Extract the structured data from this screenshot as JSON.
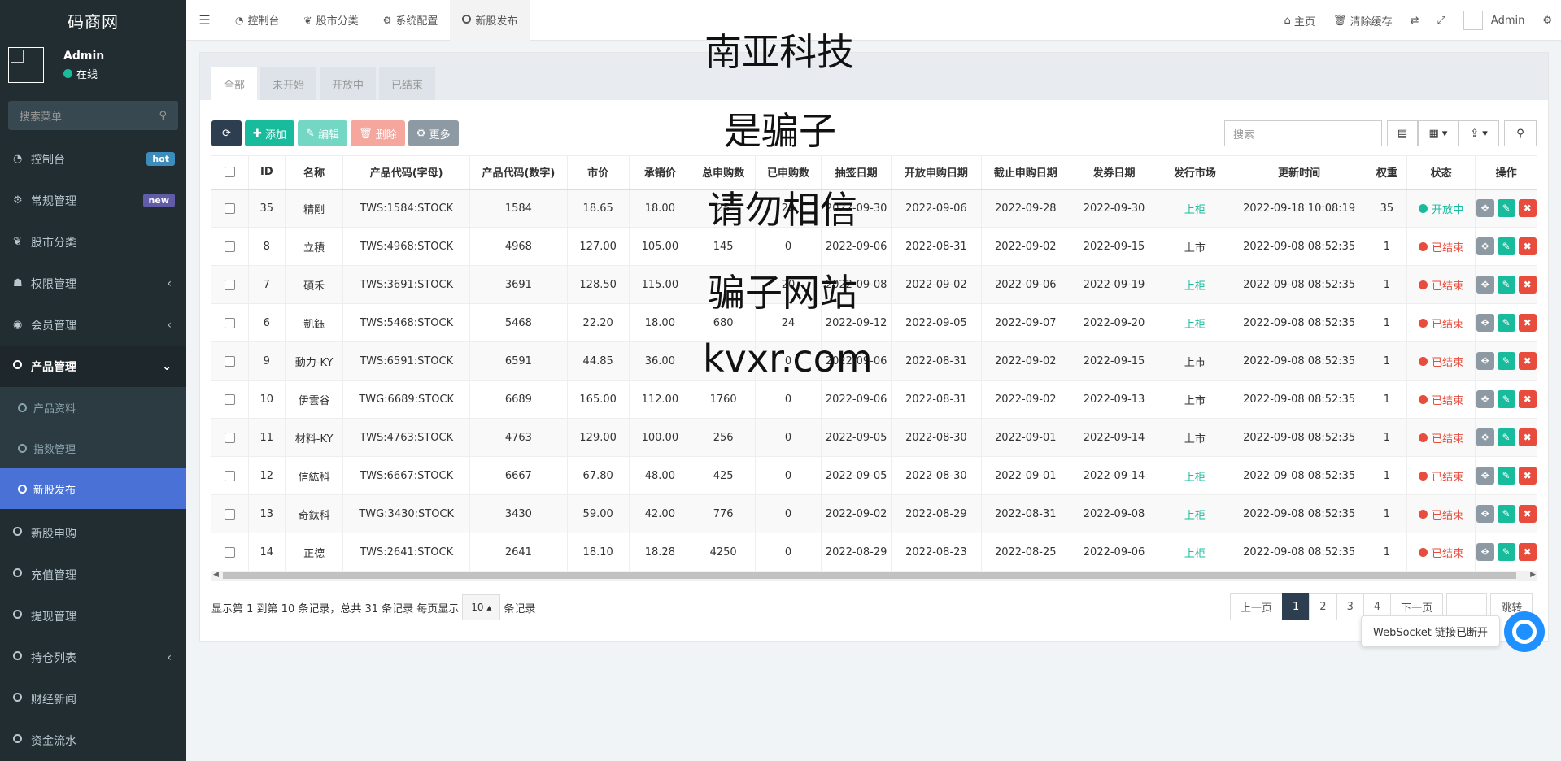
{
  "sidebar": {
    "logo": "码商网",
    "user": {
      "name": "Admin",
      "status": "在线"
    },
    "search_placeholder": "搜索菜单",
    "items": [
      {
        "label": "控制台",
        "icon": "dashboard-icon",
        "badge": "hot"
      },
      {
        "label": "常规管理",
        "icon": "cogs-icon",
        "badge": "new"
      },
      {
        "label": "股市分类",
        "icon": "leaf-icon"
      },
      {
        "label": "权限管理",
        "icon": "users-icon",
        "arrow": "‹"
      },
      {
        "label": "会员管理",
        "icon": "user-circle-icon",
        "arrow": "‹"
      },
      {
        "label": "产品管理",
        "icon": "circle-icon",
        "arrow": "⌄"
      }
    ],
    "sub_items": [
      "产品资料",
      "指数管理",
      "新股发布"
    ],
    "items_after": [
      {
        "label": "新股申购"
      },
      {
        "label": "充值管理"
      },
      {
        "label": "提现管理"
      },
      {
        "label": "持仓列表",
        "arrow": "‹"
      },
      {
        "label": "财经新闻"
      },
      {
        "label": "资金流水"
      }
    ]
  },
  "topbar": {
    "tabs": [
      "控制台",
      "股市分类",
      "系统配置",
      "新股发布"
    ],
    "right": {
      "home": "主页",
      "clear_cache": "清除缓存",
      "admin": "Admin"
    }
  },
  "panel": {
    "tabs": [
      "全部",
      "未开始",
      "开放中",
      "已结束"
    ],
    "toolbar": {
      "add": "添加",
      "edit": "编辑",
      "delete": "删除",
      "more": "更多"
    },
    "search_placeholder": "搜索"
  },
  "table": {
    "columns": [
      "ID",
      "名称",
      "产品代码(字母)",
      "产品代码(数字)",
      "市价",
      "承销价",
      "总申购数",
      "已申购数",
      "抽签日期",
      "开放申购日期",
      "截止申购日期",
      "发券日期",
      "发行市场",
      "更新时间",
      "权重",
      "状态",
      "操作"
    ],
    "rows": [
      [
        "35",
        "精剛",
        "TWS:1584:STOCK",
        "1584",
        "18.65",
        "18.00",
        "25",
        "20",
        "2022-09-30",
        "2022-09-06",
        "2022-09-28",
        "2022-09-30",
        "上柜",
        "2022-09-18 10:08:19",
        "35",
        "开放中"
      ],
      [
        "8",
        "立積",
        "TWS:4968:STOCK",
        "4968",
        "127.00",
        "105.00",
        "145",
        "0",
        "2022-09-06",
        "2022-08-31",
        "2022-09-02",
        "2022-09-15",
        "上市",
        "2022-09-08 08:52:35",
        "1",
        "已结束"
      ],
      [
        "7",
        "碩禾",
        "TWS:3691:STOCK",
        "3691",
        "128.50",
        "115.00",
        "",
        "20",
        "2022-09-08",
        "2022-09-02",
        "2022-09-06",
        "2022-09-19",
        "上柜",
        "2022-09-08 08:52:35",
        "1",
        "已结束"
      ],
      [
        "6",
        "凱鈺",
        "TWS:5468:STOCK",
        "5468",
        "22.20",
        "18.00",
        "680",
        "24",
        "2022-09-12",
        "2022-09-05",
        "2022-09-07",
        "2022-09-20",
        "上柜",
        "2022-09-08 08:52:35",
        "1",
        "已结束"
      ],
      [
        "9",
        "動力-KY",
        "TWS:6591:STOCK",
        "6591",
        "44.85",
        "36.00",
        "",
        "0",
        "2022-09-06",
        "2022-08-31",
        "2022-09-02",
        "2022-09-15",
        "上市",
        "2022-09-08 08:52:35",
        "1",
        "已结束"
      ],
      [
        "10",
        "伊雲谷",
        "TWG:6689:STOCK",
        "6689",
        "165.00",
        "112.00",
        "1760",
        "0",
        "2022-09-06",
        "2022-08-31",
        "2022-09-02",
        "2022-09-13",
        "上市",
        "2022-09-08 08:52:35",
        "1",
        "已结束"
      ],
      [
        "11",
        "材料-KY",
        "TWS:4763:STOCK",
        "4763",
        "129.00",
        "100.00",
        "256",
        "0",
        "2022-09-05",
        "2022-08-30",
        "2022-09-01",
        "2022-09-14",
        "上市",
        "2022-09-08 08:52:35",
        "1",
        "已结束"
      ],
      [
        "12",
        "信紘科",
        "TWS:6667:STOCK",
        "6667",
        "67.80",
        "48.00",
        "425",
        "0",
        "2022-09-05",
        "2022-08-30",
        "2022-09-01",
        "2022-09-14",
        "上柜",
        "2022-09-08 08:52:35",
        "1",
        "已结束"
      ],
      [
        "13",
        "奇鈦科",
        "TWG:3430:STOCK",
        "3430",
        "59.00",
        "42.00",
        "776",
        "0",
        "2022-09-02",
        "2022-08-29",
        "2022-08-31",
        "2022-09-08",
        "上柜",
        "2022-09-08 08:52:35",
        "1",
        "已结束"
      ],
      [
        "14",
        "正德",
        "TWS:2641:STOCK",
        "2641",
        "18.10",
        "18.28",
        "4250",
        "0",
        "2022-08-29",
        "2022-08-23",
        "2022-08-25",
        "2022-09-06",
        "上柜",
        "2022-09-08 08:52:35",
        "1",
        "已结束"
      ]
    ]
  },
  "footer": {
    "info_prefix": "显示第 1 到第 10 条记录，总共 31 条记录 每页显示",
    "page_size": "10",
    "info_suffix": "条记录",
    "pager": [
      "上一页",
      "1",
      "2",
      "3",
      "4",
      "下一页"
    ],
    "jump": "跳转"
  },
  "websocket_tip": "WebSocket 链接已断开",
  "watermark": [
    "南亚科技",
    "是骗子",
    "请勿相信",
    "骗子网站",
    "kvxr.com"
  ],
  "colors": {
    "sidebar_bg": "#222d32",
    "accent_green": "#18bc9c",
    "active_blue": "#4a72d6",
    "danger": "#e74c3c"
  }
}
